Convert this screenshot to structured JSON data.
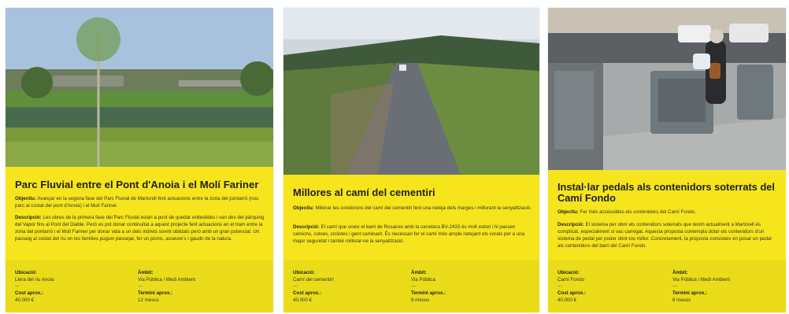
{
  "cards": [
    {
      "title": "Parc Fluvial entre el Pont d'Anoia i el Molí Fariner",
      "objective_label": "Objectiu:",
      "objective": "Avançar en la segona fase del Parc Fluvial de Martorell fent actuacions entre la zona del pontarró (nou parc al costat del pont d'Anoia) i el Molí Fariner.",
      "description_label": "Descripció:",
      "description": "Les obres de la primera fase del Parc Fluvial estan a punt de quedar enllestides i van des del pàrquing del Vapor fins al Pont del Diable. Però es pot donar continuïtat a aquest projecte fent actuacions en el tram entre la zona del pontarró i el Molí Fariner per donar vida a un dels indrets sovint oblidats però amb un gran potencial. Un passeig al costat del riu on les famílies puguin passejar, fer un picnic, asseure's i gaudir de la natura.",
      "location_label": "Ubicació:",
      "location": "Llera del riu Anoia",
      "scope_label": "Àmbit:",
      "scope": "Via Pública i Medi Ambient",
      "cost_label": "Cost aprox.:",
      "cost": "40.000 €",
      "term_label": "Termini aprox.:",
      "term": "12 mesos",
      "dash": "—"
    },
    {
      "title": "Millores al camí del cementiri",
      "objective_label": "Objectiu:",
      "objective": "Millorar les condicions del camí del cementiri fent una neteja dels marges i millorant la senyalització.",
      "description_label": "Descripció:",
      "description": "El camí que uneix el barri de Rosanes amb la carretera BV-2433 és molt estret i hi passen camions, cotxes, ciclistes i gent caminant. És necessari fer el camí més ample netejant els vorals per a una major seguretat i també millorar-ne la senyalització.",
      "location_label": "Ubicació:",
      "location": "Camí del cementiri",
      "scope_label": "Àmbit:",
      "scope": "Via Pública",
      "cost_label": "Cost aprox.:",
      "cost": "40.000 €",
      "term_label": "Termini aprox.:",
      "term": "8 mesos",
      "dash": "—"
    },
    {
      "title": "Instal·lar pedals als contenidors soterrats del Camí Fondo",
      "objective_label": "Objectiu:",
      "objective": "Fer més accessibles els contenidors del Camí Fondo.",
      "description_label": "Descripció:",
      "description": "El sistema per obrir els contenidors soterrats que tenim actualment a Martorell és complicat, especialment si vas carregat. Aquesta proposta contempla dotar els contenidors d'un sistema de pedal per poder obrir-los millor. Concretament, la proposta consisteix en posar un pedal als contenidors del barri del Camí Fondo.",
      "location_label": "Ubicació:",
      "location": "Camí Fondo",
      "scope_label": "Àmbit:",
      "scope": "Via Pública i Medi Ambient",
      "cost_label": "Cost aprox.:",
      "cost": "40.000 €",
      "term_label": "Termini aprox.:",
      "term": "8 mesos",
      "dash": "—"
    }
  ],
  "photos": [
    "river-park-photo",
    "cemetery-road-photo",
    "underground-containers-photo"
  ],
  "colors": {
    "card_yellow": "#f6e51c",
    "meta_yellow": "#eadc18",
    "text_dark": "#222222"
  }
}
